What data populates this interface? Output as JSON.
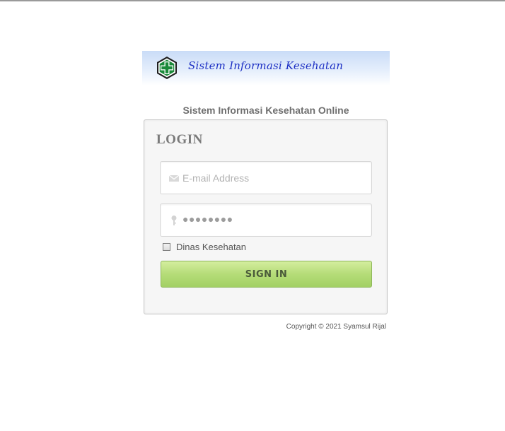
{
  "header": {
    "banner_title": "Sistem Informasi Kesehatan"
  },
  "page": {
    "subtitle": "Sistem Informasi Kesehatan Online"
  },
  "login": {
    "heading": "LOGIN",
    "email_placeholder": "E-mail Address",
    "email_value": "",
    "password_masked": "●●●●●●●●",
    "checkbox_label": "Dinas Kesehatan",
    "checkbox_checked": false,
    "submit_label": "SIGN IN"
  },
  "footer": {
    "copyright": "Copyright © 2021 Syamsul Rijal"
  },
  "icons": {
    "logo": "health-cross-logo-icon",
    "email": "envelope-icon",
    "password": "key-icon"
  },
  "colors": {
    "banner_text": "#1c2fc4",
    "button_green": "#b5dc78",
    "logo_green": "#1a8a3a"
  }
}
